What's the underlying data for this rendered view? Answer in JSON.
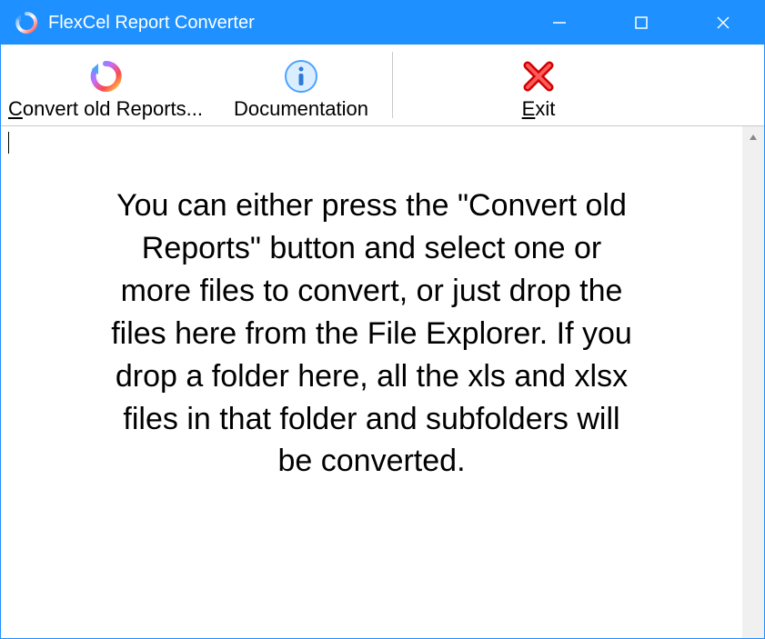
{
  "titlebar": {
    "title": "FlexCel Report Converter"
  },
  "toolbar": {
    "convert_label": "Convert old Reports...",
    "documentation_label": "Documentation",
    "exit_label": "Exit"
  },
  "main": {
    "instructions_text": "You can either press the \"Convert old Reports\" button and select one or more files to convert, or just drop the files here from the File Explorer. If you drop a folder here, all the xls and xlsx files in that folder and subfolders will be converted."
  }
}
